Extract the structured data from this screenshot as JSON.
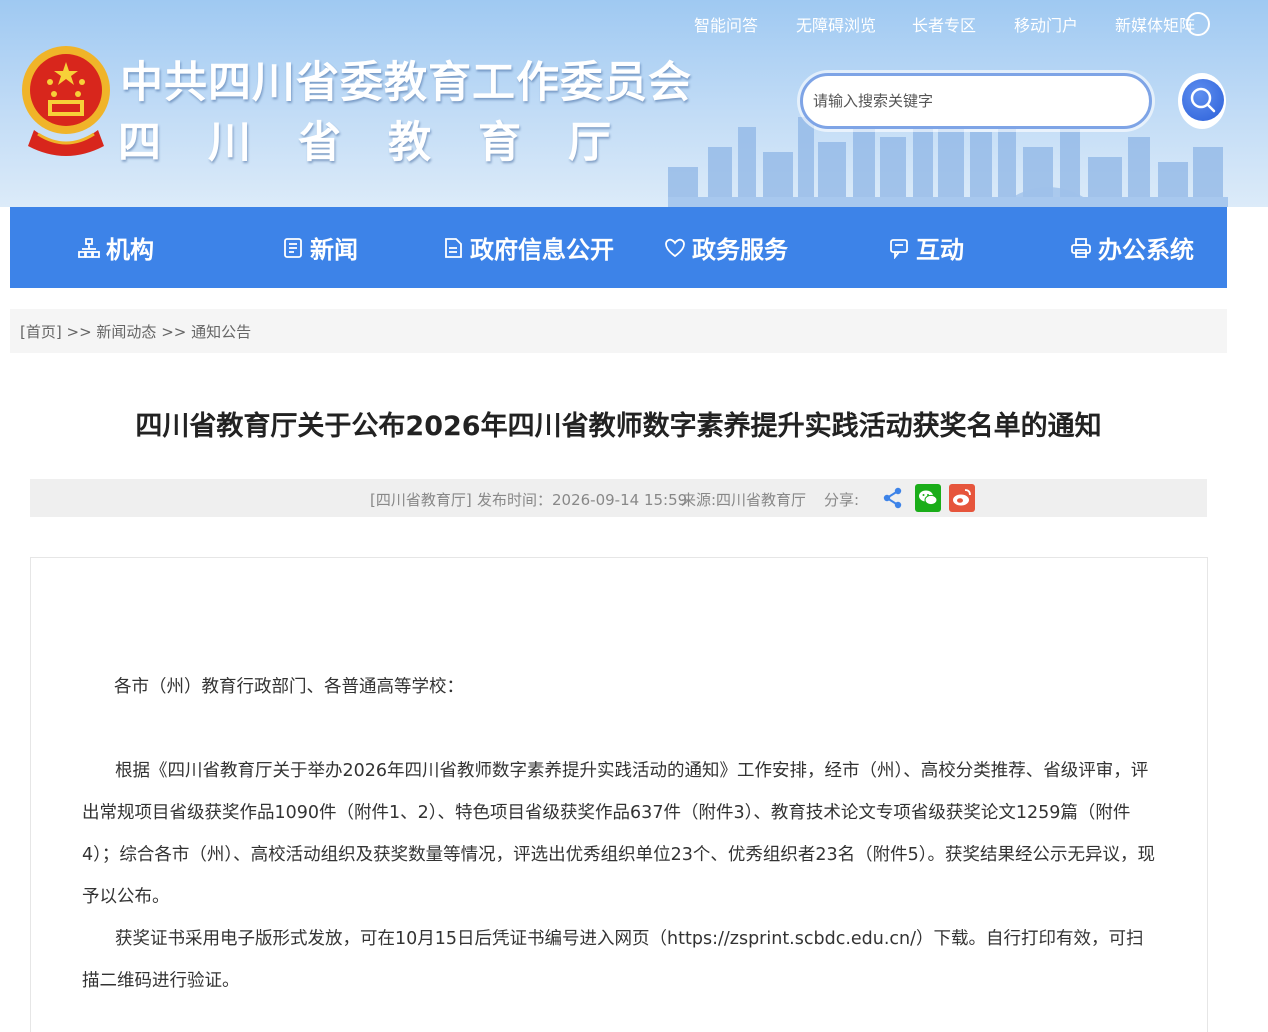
{
  "header": {
    "title_main": "中共四川省委教育工作委员会",
    "title_sub": "四川省教育厅",
    "top_links": [
      "智能问答",
      "无障碍浏览",
      "长者专区",
      "移动门户",
      "新媒体矩阵"
    ],
    "search_placeholder": "请输入搜索关键字"
  },
  "nav": {
    "items": [
      {
        "label": "机构",
        "icon": "org-chart-icon"
      },
      {
        "label": "新闻",
        "icon": "news-icon"
      },
      {
        "label": "政府信息公开",
        "icon": "document-icon"
      },
      {
        "label": "政务服务",
        "icon": "heart-service-icon"
      },
      {
        "label": "互动",
        "icon": "chat-icon"
      },
      {
        "label": "办公系统",
        "icon": "printer-icon"
      }
    ]
  },
  "breadcrumb": {
    "home": "[首页]",
    "sep": ">>",
    "level1": "新闻动态",
    "level2": "通知公告"
  },
  "article": {
    "title": "四川省教育厅关于公布2026年四川省教师数字素养提升实践活动获奖名单的通知",
    "meta": {
      "publisher": "[四川省教育厅]",
      "publish_time": "发布时间：2026-09-14 15:59",
      "source": "来源:四川省教育厅",
      "share_label": "分享:"
    },
    "paragraphs": [
      "各市（州）教育行政部门、各普通高等学校：",
      "根据《四川省教育厅关于举办2026年四川省教师数字素养提升实践活动的通知》工作安排，经市（州）、高校分类推荐、省级评审，评出常规项目省级获奖作品1090件（附件1、2）、特色项目省级获奖作品637件（附件3）、教育技术论文专项省级获奖论文1259篇（附件4）；综合各市（州）、高校活动组织及获奖数量等情况，评选出优秀组织单位23个、优秀组织者23名（附件5）。获奖结果经公示无异议，现予以公布。",
      "获奖证书采用电子版形式发放，可在10月15日后凭证书编号进入网页（https://zsprint.scbdc.edu.cn/）下载。自行打印有效，可扫描二维码进行验证。"
    ]
  },
  "colors": {
    "nav_bg": "#3d83e8",
    "header_bg": "#a9cff4",
    "wechat": "#1aad19",
    "weibo": "#e6553c",
    "share": "#3d83e8"
  }
}
